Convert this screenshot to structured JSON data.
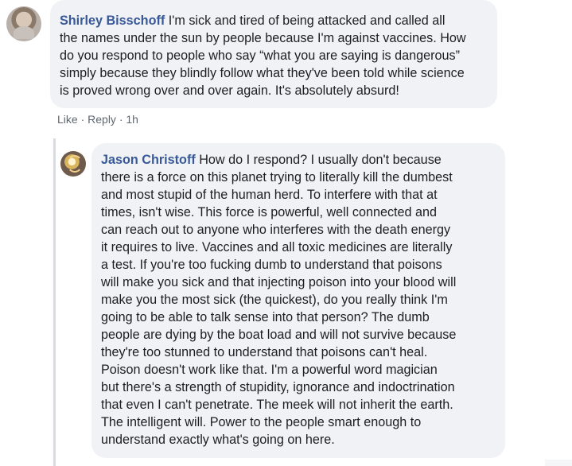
{
  "comments": [
    {
      "author": "Shirley Bisschoff",
      "body_lines": [
        "I'm sick and tired of being attacked and called all",
        "the names under the sun by people because I'm against vaccines. How",
        "do you respond to people who say “what you are saying is dangerous”",
        "simply because they blindly follow what they've been told while science",
        "is proved wrong over and over again. It's absolutely absurd!"
      ],
      "actions": {
        "like": "Like",
        "separator_1": " · ",
        "reply": "Reply",
        "separator_2": " · ",
        "time": "1h"
      }
    },
    {
      "author": "Jason Christoff",
      "body_lines": [
        "How do I respond? I usually don't because",
        "there is a force on this planet trying to literally kill the dumbest",
        "and most stupid of the human herd. To interfere with that at",
        "times, isn't wise. This force is powerful, well connected and",
        "can reach out to anyone who interferes with the death energy",
        "it requires to live. Vaccines and all toxic medicines are literally",
        "a test. If you're too fucking dumb to understand that poisons",
        "will make you sick and that injecting poison into your blood will",
        "make you the most sick (the quickest), do you really think I'm",
        "going to be able to talk sense into that person? The dumb",
        "people are dying by the boat load and will not survive because",
        "they're too stunned to understand that poisons can't heal.",
        "Poison doesn't work like that. I'm a powerful word magician",
        "but there's a strength of stupidity, ignorance and indoctrination",
        "that even I can't penetrate. The meek will not inherit the earth.",
        "The intelligent will. Power to the people smart enough to",
        "understand exactly what's going on here."
      ]
    }
  ],
  "icons": {
    "avatar_1": "profile-photo",
    "avatar_2": "profile-photo"
  },
  "colors": {
    "author_name": "#385898",
    "bubble_background": "#f0f2f5",
    "meta_text": "#606770"
  }
}
